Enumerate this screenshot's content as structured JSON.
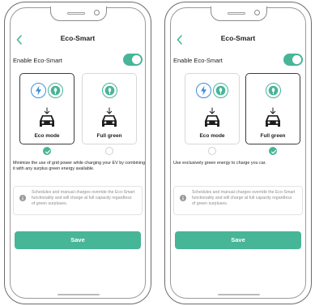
{
  "colors": {
    "accent": "#47b597",
    "bolt_blue": "#3b8fde",
    "text": "#1e1e1e",
    "muted": "#8d8d8d"
  },
  "screens": [
    {
      "title": "Eco-Smart",
      "enable_label": "Enable Eco-Smart",
      "toggle_on": true,
      "options": [
        {
          "label": "Eco mode",
          "icons": [
            "bolt-icon",
            "leaf-icon"
          ],
          "selected": true
        },
        {
          "label": "Full green",
          "icons": [
            "leaf-icon"
          ],
          "selected": false
        }
      ],
      "description": "Minimize the use of grid power while charging your EV by combining it with any surplus green energy available.",
      "info": "Schedules and manual charges override the Eco-Smart functionality and will charge at full capacity regardless of green surpluses.",
      "save_label": "Save"
    },
    {
      "title": "Eco-Smart",
      "enable_label": "Enable Eco-Smart",
      "toggle_on": true,
      "options": [
        {
          "label": "Eco mode",
          "icons": [
            "bolt-icon",
            "leaf-icon"
          ],
          "selected": false
        },
        {
          "label": "Full green",
          "icons": [
            "leaf-icon"
          ],
          "selected": true
        }
      ],
      "description": "Use exclusively green energy to charge you car.",
      "info": "Schedules and manual charges override the Eco-Smart functionality and will charge at full capacity regardless of green surpluses.",
      "save_label": "Save"
    }
  ]
}
